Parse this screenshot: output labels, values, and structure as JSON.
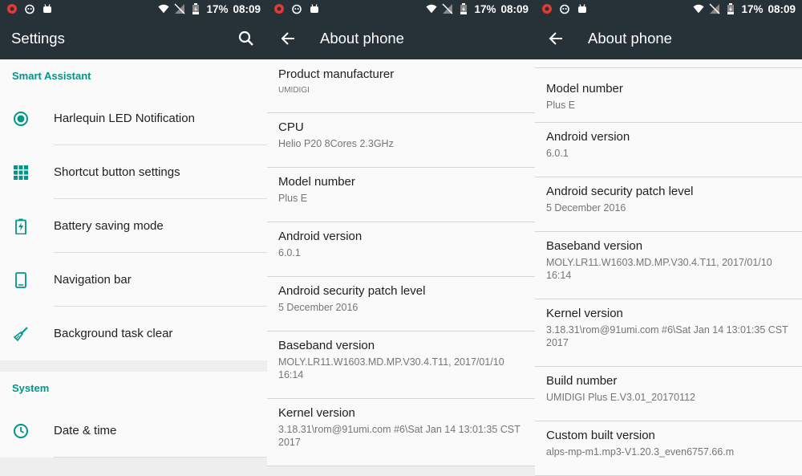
{
  "status": {
    "battery": "17%",
    "time": "08:09"
  },
  "settings": {
    "title": "Settings",
    "smart_assistant_header": "Smart Assistant",
    "items": [
      {
        "label": "Harlequin LED Notification",
        "icon": "led-icon"
      },
      {
        "label": "Shortcut button settings",
        "icon": "grid-icon"
      },
      {
        "label": "Battery saving mode",
        "icon": "battery-icon"
      },
      {
        "label": "Navigation bar",
        "icon": "phone-icon"
      },
      {
        "label": "Background task clear",
        "icon": "broom-icon"
      }
    ],
    "system_header": "System",
    "system_items": [
      {
        "label": "Date & time",
        "icon": "clock-icon"
      }
    ]
  },
  "about1": {
    "title": "About phone",
    "rows": [
      {
        "title": "Product manufacturer",
        "value": "UMIDIGI"
      },
      {
        "title": "CPU",
        "value": "Helio P20  8Cores 2.3GHz"
      },
      {
        "title": "Model number",
        "value": "Plus E"
      },
      {
        "title": "Android version",
        "value": "6.0.1"
      },
      {
        "title": "Android security patch level",
        "value": "5 December 2016"
      },
      {
        "title": "Baseband version",
        "value": "MOLY.LR11.W1603.MD.MP.V30.4.T11, 2017/01/10 16:14"
      },
      {
        "title": "Kernel version",
        "value": "3.18.31\\rom@91umi.com #6\\Sat Jan 14 13:01:35 CST 2017"
      }
    ]
  },
  "about2": {
    "title": "About phone",
    "rows": [
      {
        "title": "Model number",
        "value": "Plus E"
      },
      {
        "title": "Android version",
        "value": "6.0.1"
      },
      {
        "title": "Android security patch level",
        "value": "5 December 2016"
      },
      {
        "title": "Baseband version",
        "value": "MOLY.LR11.W1603.MD.MP.V30.4.T11, 2017/01/10 16:14"
      },
      {
        "title": "Kernel version",
        "value": "3.18.31\\rom@91umi.com #6\\Sat Jan 14 13:01:35 CST 2017"
      },
      {
        "title": "Build number",
        "value": "UMIDIGI  Plus E.V3.01_20170112"
      },
      {
        "title": "Custom built version",
        "value": "alps-mp-m1.mp3-V1.20.3_even6757.66.m"
      }
    ]
  },
  "colors": {
    "appbar": "#263238",
    "accent": "#009688"
  }
}
